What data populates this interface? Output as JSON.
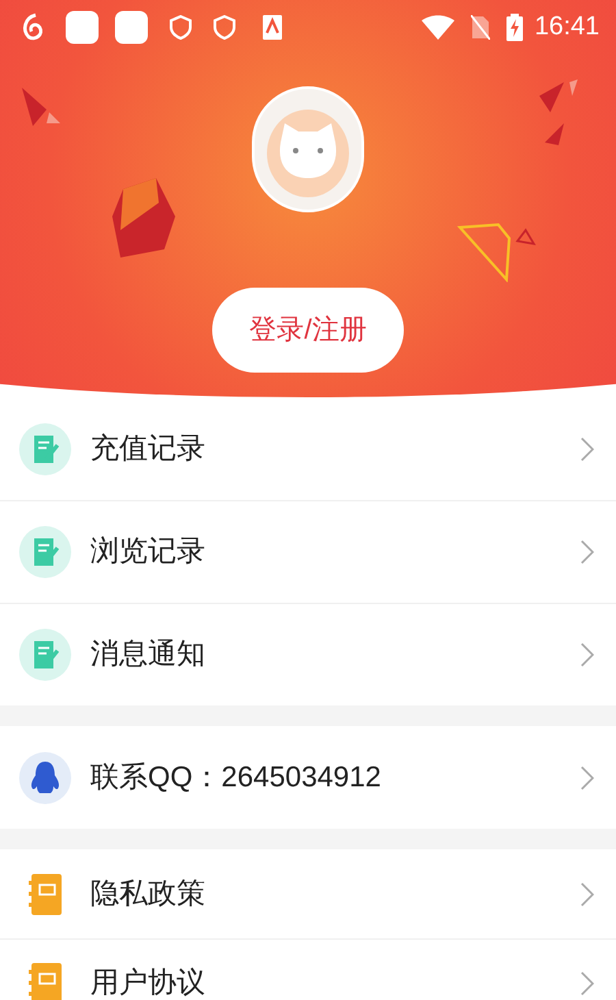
{
  "status_bar": {
    "time": "16:41"
  },
  "header": {
    "login_button": "登录/注册"
  },
  "groups": [
    {
      "items": [
        {
          "kind": "notes",
          "label": "充值记录"
        },
        {
          "kind": "notes",
          "label": "浏览记录"
        },
        {
          "kind": "notes",
          "label": "消息通知"
        }
      ]
    },
    {
      "items": [
        {
          "kind": "qq",
          "label": "联系QQ：2645034912"
        }
      ]
    },
    {
      "items": [
        {
          "kind": "book",
          "label": "隐私政策"
        },
        {
          "kind": "book",
          "label": "用户协议"
        }
      ]
    }
  ]
}
